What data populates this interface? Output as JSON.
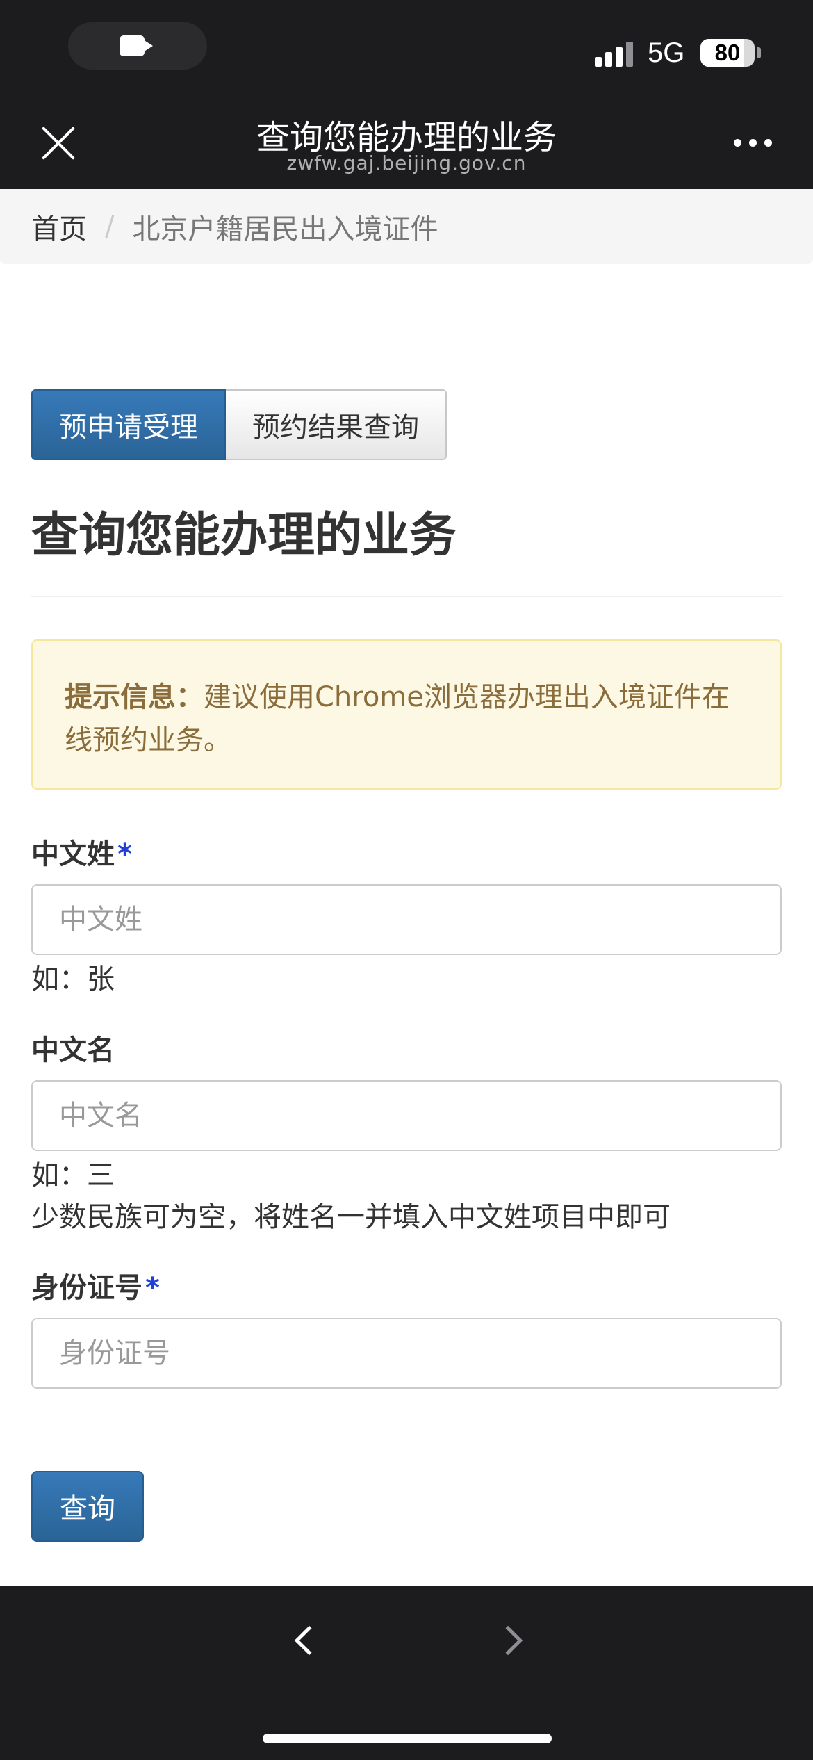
{
  "status_bar": {
    "network": "5G",
    "battery": "80",
    "battery_level": 0.8
  },
  "header": {
    "title": "查询您能办理的业务",
    "domain": "zwfw.gaj.beijing.gov.cn"
  },
  "breadcrumb": {
    "home": "首页",
    "separator": "/",
    "current": "北京户籍居民出入境证件"
  },
  "tabs": [
    {
      "label": "预申请受理",
      "active": true
    },
    {
      "label": "预约结果查询",
      "active": false
    }
  ],
  "page_title": "查询您能办理的业务",
  "alert": {
    "title": "提示信息：",
    "text": "建议使用Chrome浏览器办理出入境证件在线预约业务。"
  },
  "form": {
    "surname": {
      "label": "中文姓",
      "required_mark": "*",
      "placeholder": "中文姓",
      "value": "",
      "help": "如：张"
    },
    "given_name": {
      "label": "中文名",
      "placeholder": "中文名",
      "value": "",
      "help": "如：三",
      "note": "少数民族可为空，将姓名一并填入中文姓项目中即可"
    },
    "id_number": {
      "label": "身份证号",
      "required_mark": "*",
      "placeholder": "身份证号",
      "value": ""
    },
    "submit_label": "查询"
  },
  "colors": {
    "primary": "#2a6496",
    "alert_bg": "#fcf8e3",
    "alert_text": "#8a6d3b",
    "required": "#1f3fd8",
    "chrome": "#1c1c1e"
  }
}
